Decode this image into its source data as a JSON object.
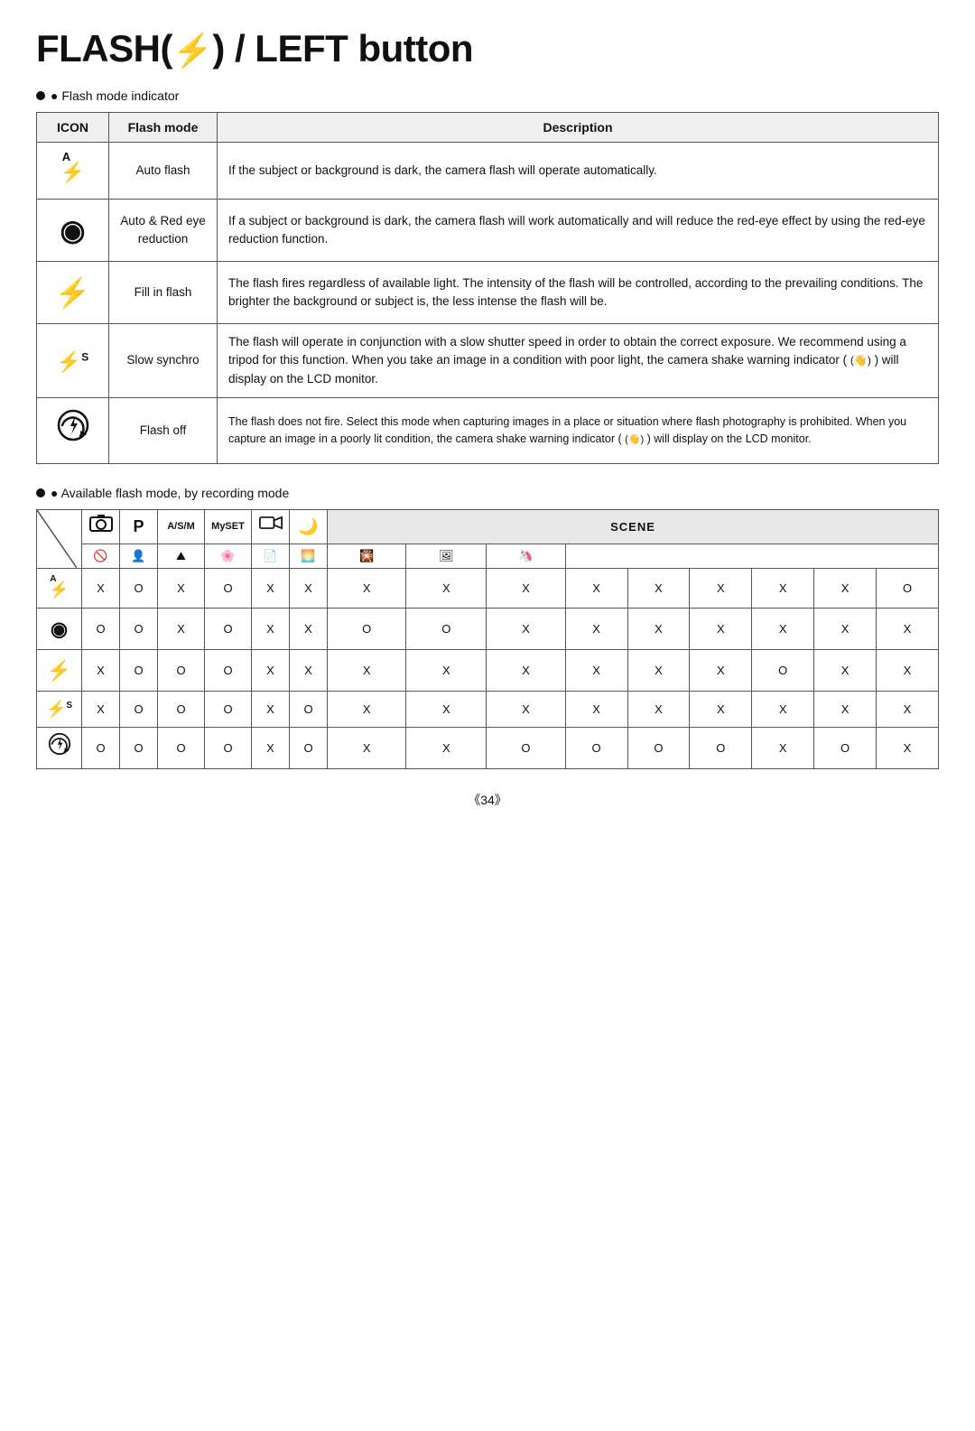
{
  "title": "FLASH(",
  "title_mid": "⚡",
  "title_end": " ) / LEFT button",
  "flash_label": "● Flash mode indicator",
  "table_headers": {
    "icon": "ICON",
    "flash_mode": "Flash mode",
    "description": "Description"
  },
  "table_rows": [
    {
      "icon": "⚡A",
      "icon_type": "auto-flash",
      "mode": "Auto flash",
      "description": "If the subject or background is dark, the camera flash will operate automatically."
    },
    {
      "icon": "👁",
      "icon_type": "eye",
      "mode": "Auto & Red eye\nreduction",
      "description": "If a subject or background is dark, the camera flash will work automatically and will reduce the red-eye effect by using the red-eye reduction function."
    },
    {
      "icon": "⚡",
      "icon_type": "lightning",
      "mode": "Fill in flash",
      "description": "The flash fires regardless of available light.  The intensity of the flash will be controlled, according to the prevailing conditions. The brighter the background or subject is, the less intense the flash will be."
    },
    {
      "icon": "⚡S",
      "icon_type": "lightning-s",
      "mode": "Slow synchro",
      "description": "The flash will operate in conjunction with a slow shutter speed in order to obtain the correct exposure. We recommend using a tripod for this function. When you take an image in a condition with poor light, the camera shake warning indicator ( 〈☞〉 ) will display on the LCD monitor."
    },
    {
      "icon": "🔄⚡",
      "icon_type": "flash-off",
      "mode": "Flash off",
      "description": "The flash does not fire. Select this mode when capturing images in a place or situation where flash photography is prohibited. When you capture an image in a poorly lit condition, the camera shake warning indicator ( 〈☞〉 ) will display on the LCD monitor."
    }
  ],
  "avail_label": "● Available flash mode, by recording mode",
  "avail_table": {
    "scene_header": "SCENE",
    "col_headers": [
      "",
      "🟦P",
      "A/S/M",
      "MySET",
      "🎞",
      "🌙",
      "🚫",
      "👤",
      "⛰",
      "🌸",
      "📄",
      "🌅",
      "🎇",
      "🖼",
      "🦄"
    ],
    "row_icons": [
      "⚡A",
      "👁",
      "⚡",
      "⚡S",
      "🔄"
    ],
    "data": [
      [
        "X",
        "O",
        "X",
        "O",
        "X",
        "X",
        "X",
        "X",
        "X",
        "X",
        "X",
        "X",
        "X",
        "X",
        "O"
      ],
      [
        "O",
        "O",
        "X",
        "O",
        "X",
        "X",
        "O",
        "O",
        "X",
        "X",
        "X",
        "X",
        "X",
        "X",
        "X"
      ],
      [
        "X",
        "O",
        "O",
        "O",
        "X",
        "X",
        "X",
        "X",
        "X",
        "X",
        "X",
        "X",
        "O",
        "X",
        "X"
      ],
      [
        "X",
        "O",
        "O",
        "O",
        "X",
        "O",
        "X",
        "X",
        "X",
        "X",
        "X",
        "X",
        "X",
        "X",
        "X"
      ],
      [
        "O",
        "O",
        "O",
        "O",
        "X",
        "O",
        "X",
        "X",
        "O",
        "O",
        "O",
        "O",
        "X",
        "O",
        "X"
      ]
    ]
  },
  "page_number": "《34》"
}
